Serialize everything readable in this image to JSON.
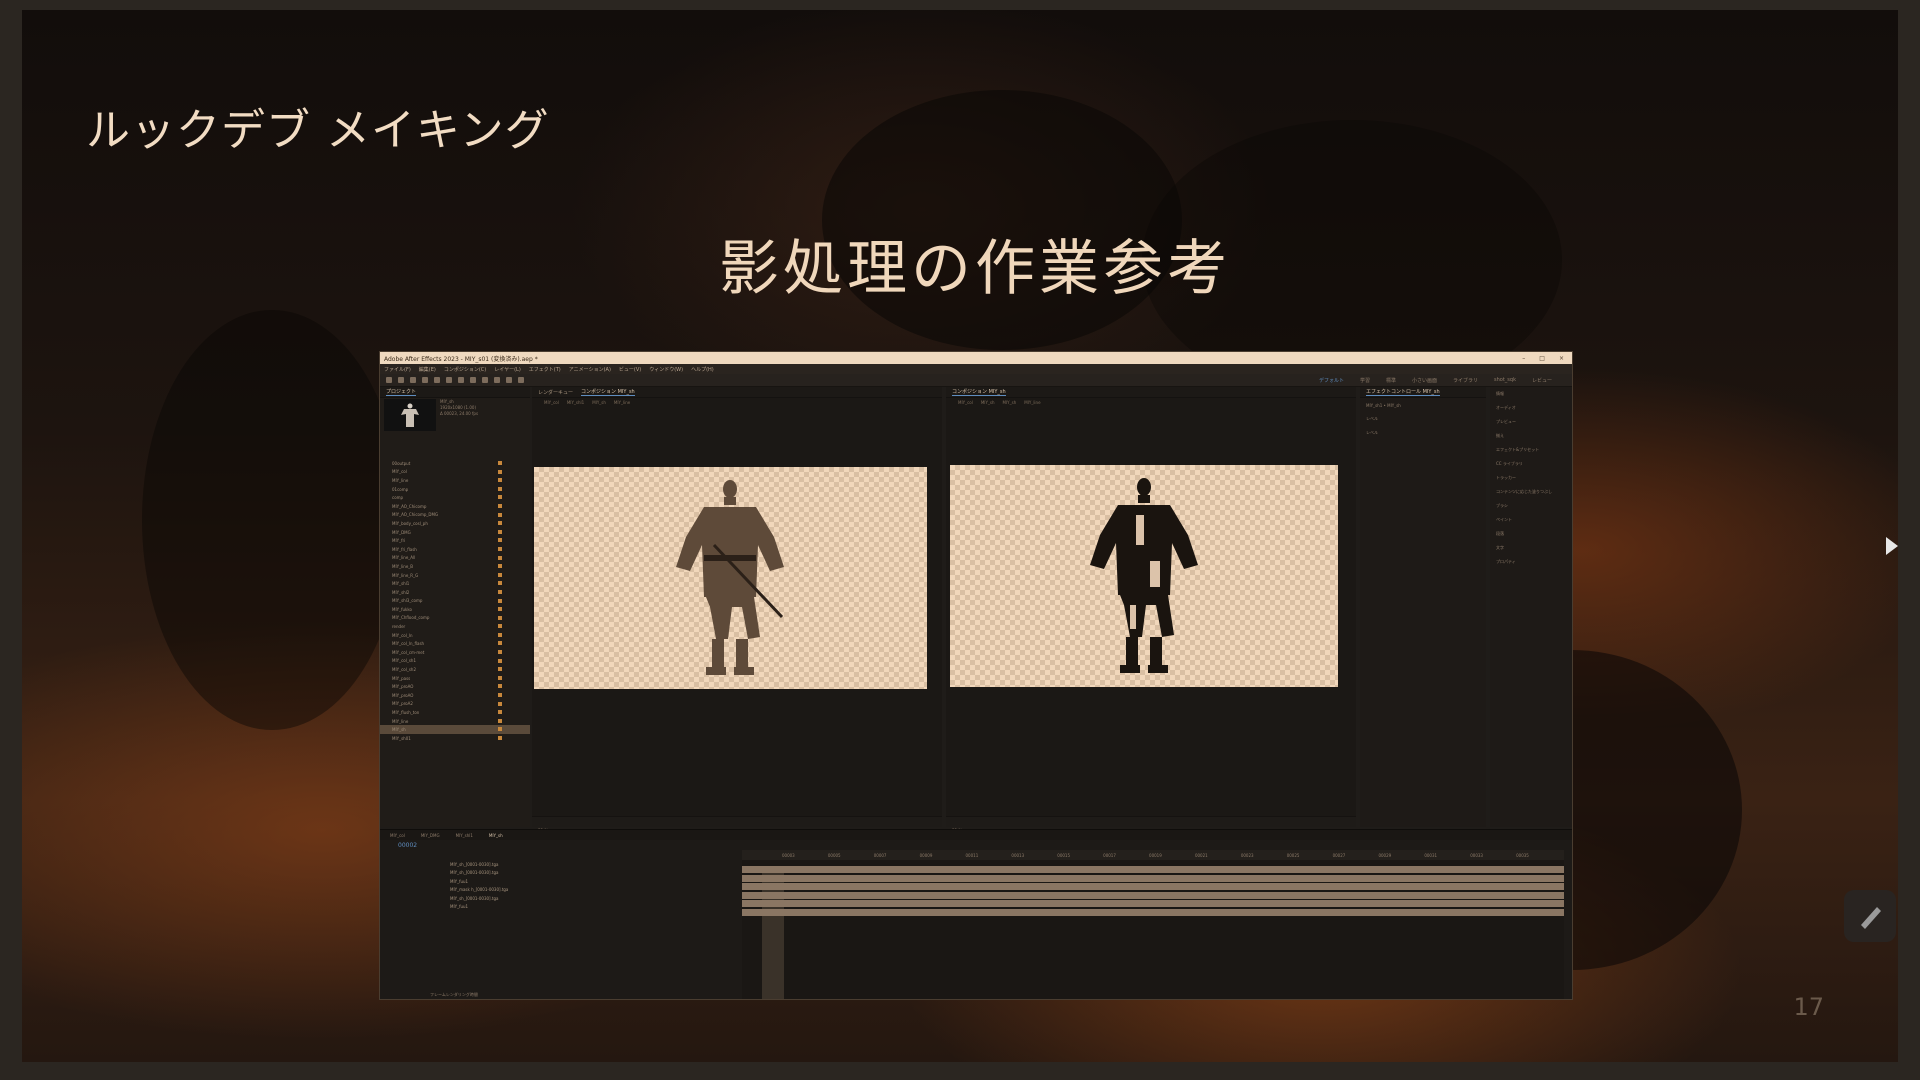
{
  "slide": {
    "heading": "ルックデブ メイキング",
    "title": "影処理の作業参考",
    "page_number": "17"
  },
  "ae_window": {
    "title": "Adobe After Effects 2023 - MIY_s01 (変換済み).aep *",
    "menu": [
      "ファイル(F)",
      "編集(E)",
      "コンポジション(C)",
      "レイヤー(L)",
      "エフェクト(T)",
      "アニメーション(A)",
      "ビュー(V)",
      "ウィンドウ(W)",
      "ヘルプ(H)"
    ],
    "workspaces": [
      "デフォルト",
      "学習",
      "標準",
      "小さい画面",
      "ライブラリ",
      "shot_sqk",
      "レビュー"
    ],
    "project_panel": {
      "tab": "プロジェクト",
      "selected_name": "MIY_sh",
      "meta": [
        "1920x1080 (1.00)",
        "Δ 00023, 24.00 fps"
      ],
      "rows": [
        "00output",
        "MIY_col",
        "MIY_line",
        "01comp",
        "comp",
        "MIY_AO_Chicomp",
        "MIY_AO_Chicomp_DMG",
        "MIY_body_cosl_ph",
        "MIY_DMG",
        "MIY_fri",
        "MIY_fri_flash",
        "MIY_line_All",
        "MIY_line_B",
        "MIY_line_R_G",
        "MIY_shl1",
        "MIY_shl2",
        "MIY_shl3_comp",
        "MIY_fukko",
        "MIY_Chflood_comp",
        "render",
        "MIY_col_ln",
        "MIY_col_ln_flash",
        "MIY_col_cm-met",
        "MIY_col_sh1",
        "MIY_col_sh2",
        "MIY_pass",
        "MIY_proAO",
        "MIY_proAO",
        "MIY_proA2",
        "MIY_flush_ton",
        "MIY_line",
        "MIY_sh",
        "MIY_sh01"
      ],
      "selected_index": 31
    },
    "viewer_left": {
      "tabs": [
        "レンダーキュー",
        "コンポジション MIY_sh"
      ],
      "subtabs": [
        "MIY_col",
        "MIY_shl1",
        "MIY_sh",
        "MIY_line"
      ],
      "zoom": "33 %"
    },
    "viewer_right": {
      "tabs": [
        "コンポジション MIY_sh"
      ],
      "subtabs": [
        "MIY_col",
        "MIY_sh",
        "MIY_sh",
        "MIY_line"
      ],
      "zoom": "33 %"
    },
    "effects_panel": {
      "tab": "エフェクトコントロール MIY_sh",
      "rows": [
        "MIY_sh1 • MIY_sh",
        "レベル",
        "レベル"
      ]
    },
    "right_column": [
      "情報",
      "オーディオ",
      "プレビュー",
      "揃え",
      "エフェクト&プリセット",
      "CC ライブラリ",
      "トラッカー",
      "コンテンツに応じた塗りつぶし",
      "ブラシ",
      "ペイント",
      "段落",
      "文字",
      "プロパティ"
    ],
    "timeline": {
      "tabs": [
        "MIY_col",
        "MIY_DMG",
        "MIY_shl1",
        "MIY_sh"
      ],
      "timecode": "00002",
      "ruler": [
        "00003",
        "00005",
        "00007",
        "00009",
        "00011",
        "00013",
        "00015",
        "00017",
        "00019",
        "00021",
        "00023",
        "00025",
        "00027",
        "00029",
        "00031",
        "00033",
        "00035"
      ],
      "layers": [
        "MIY_sh_[0001-0030].tga",
        "MIY_sh_[0001-0030].tga",
        "MIY_fuu1",
        "MIY_mask h_[0001-0030].tga",
        "MIY_sh_[0001-0030].tga",
        "MIY_fuu1"
      ],
      "footer": "フレームレンダリング時間"
    }
  }
}
